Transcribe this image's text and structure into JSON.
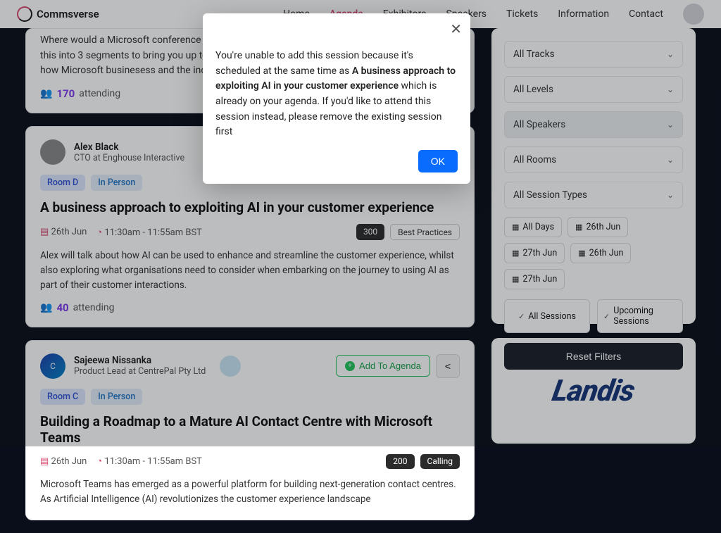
{
  "brand": "Commsverse",
  "nav": {
    "home": "Home",
    "agenda": "Agenda",
    "exhibitors": "Exhibitors",
    "speakers": "Speakers",
    "tickets": "Tickets",
    "information": "Information",
    "contact": "Contact"
  },
  "session0": {
    "snippet": "Where would a Microsoft conference be without a keynote about Microsoft Teams. We've split this into 3 segments to bring you up to speed with what's landing in the next 12 months. See how Microsoft businesess and the industry are enriching the Teams experience.",
    "count": "170",
    "label": "attending"
  },
  "session1": {
    "speaker": "Alex Black",
    "role": "CTO at Enghouse Interactive",
    "room": "Room D",
    "mode": "In Person",
    "title": "A business approach to exploiting AI in your customer experience",
    "date": "26th Jun",
    "time": "11:30am - 11:55am BST",
    "cap": "300",
    "tag": "Best Practices",
    "desc": "Alex will talk about how AI can be used to enhance and streamline the customer experience, whilst also exploring what organisations need to consider when embarking on the journey to using AI as part of their customer interactions.",
    "count": "40",
    "label": "attending"
  },
  "session2": {
    "speaker": "Sajeewa Nissanka",
    "role": "Product Lead at CentrePal Pty Ltd",
    "add": "Add To Agenda",
    "room": "Room C",
    "mode": "In Person",
    "title": "Building a Roadmap to a Mature AI Contact Centre with Microsoft Teams",
    "date": "26th Jun",
    "time": "11:30am - 11:55am BST",
    "cap": "200",
    "tag": "Calling",
    "desc": "Microsoft Teams has emerged as a powerful platform for building next-generation contact centres. As Artificial Intelligence (AI) revolutionizes the customer experience landscape"
  },
  "filters": {
    "tracks": "All Tracks",
    "levels": "All Levels",
    "speakers": "All Speakers",
    "rooms": "All Rooms",
    "types": "All Session Types",
    "days": [
      "All Days",
      "26th Jun",
      "27th Jun",
      "26th Jun",
      "27th Jun"
    ],
    "seg_all": "All Sessions",
    "seg_upcoming": "Upcoming Sessions",
    "reset": "Reset Filters"
  },
  "sponsor": "Landis",
  "modal": {
    "pre": "You're unable to add this session because it's scheduled at the same time as ",
    "bold": "A business approach to exploiting AI in your customer experience",
    "post": " which is already on your agenda. If you'd like to attend this session instead, please remove the existing session first",
    "ok": "OK"
  }
}
